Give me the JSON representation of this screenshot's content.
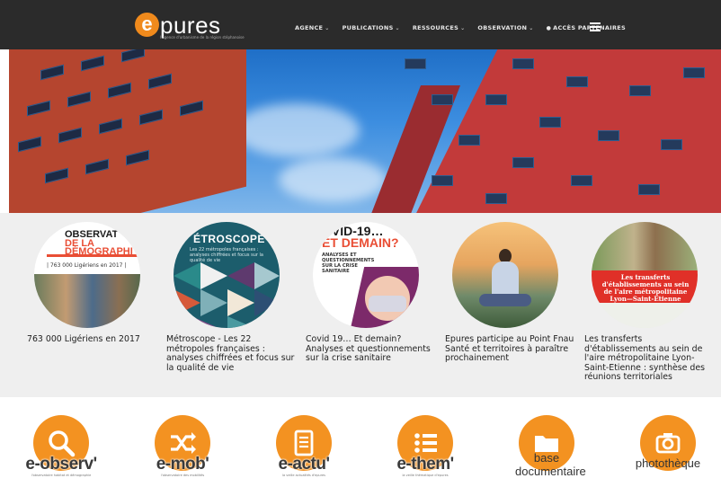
{
  "brand": {
    "logo_letter": "e",
    "logo_word": "pures",
    "tagline": "l'agence d'urbanisme de la région stéphanoise"
  },
  "nav": {
    "items": [
      {
        "label": "AGENCE"
      },
      {
        "label": "PUBLICATIONS"
      },
      {
        "label": "RESSOURCES"
      },
      {
        "label": "OBSERVATION"
      },
      {
        "label": "ACCÈS PARTENAIRES"
      }
    ],
    "caret": "⌄",
    "lock": "🔒"
  },
  "articles": [
    {
      "title": "763 000 Ligériens en 2017",
      "thumb": {
        "line1": "OBSERVAT",
        "line2": "DE LA",
        "line3": "DÉMOGRAPHI",
        "sub": "| 763 000 Ligériens en 2017 |"
      }
    },
    {
      "title": "Métroscope - Les 22 métropoles françaises : analyses chiffrées et focus sur la qualité de vie",
      "thumb": {
        "line1": "ÉTROSCOPE",
        "sub": "Les 22 métropoles françaises : analyses chiffrées et focus sur la qualité de vie"
      }
    },
    {
      "title": "Covid 19… Et demain? Analyses et questionnements sur la crise sanitaire",
      "thumb": {
        "line1": "OVID-19…",
        "line2": "ET DEMAIN?",
        "sub": "ANALYSES ET QUESTIONNEMENTS SUR LA CRISE SANITAIRE"
      }
    },
    {
      "title": "Epures participe au Point Fnau Santé et territoires à paraître prochainement",
      "thumb": {}
    },
    {
      "title": "Les transferts d'établissements au sein de l'aire métropolitaine Lyon-Saint-Etienne : synthèse des réunions territoriales",
      "thumb": {
        "band": "Les transferts d'établissements au sein de l'aire métropolitaine Lyon—Saint-Etienne"
      }
    }
  ],
  "links": [
    {
      "label": "e-observ'",
      "tagline": "l'observatoire habitat et démographie",
      "icon": "search-icon"
    },
    {
      "label": "e-mob'",
      "tagline": "l'observatoire des mobilités",
      "icon": "shuffle-icon"
    },
    {
      "label": "e-actu'",
      "tagline": "la veille actualités d'epures",
      "icon": "document-icon"
    },
    {
      "label": "e-them'",
      "tagline": "la veille thématique d'epures",
      "icon": "list-icon"
    },
    {
      "label": "base documentaire",
      "icon": "folder-icon"
    },
    {
      "label": "photothèque",
      "icon": "camera-icon"
    }
  ],
  "colors": {
    "accent": "#f39221",
    "navbar": "#2b2b2b",
    "strip": "#efefef"
  }
}
